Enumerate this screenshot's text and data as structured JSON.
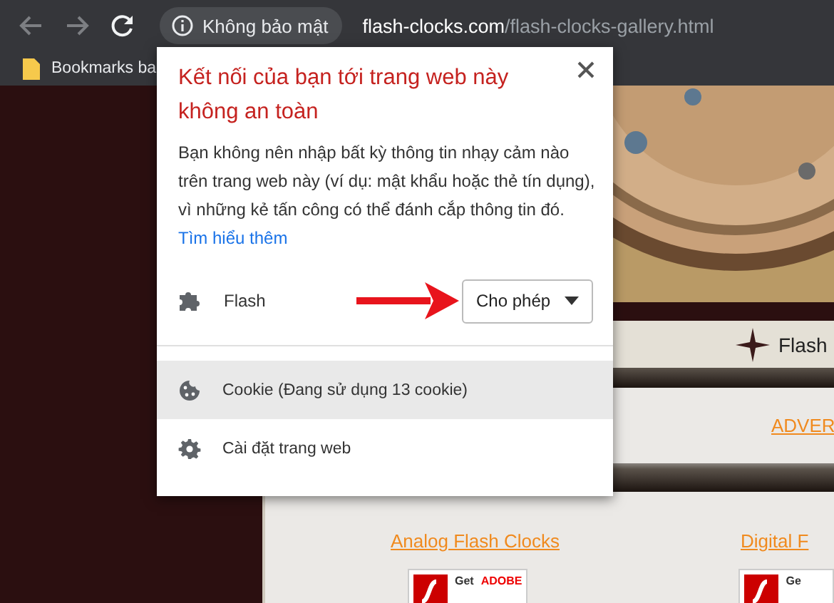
{
  "toolbar": {
    "nav_buttons": [
      {
        "kind": "back",
        "disabled": true
      },
      {
        "kind": "forward",
        "disabled": true
      },
      {
        "kind": "reload",
        "disabled": false
      }
    ],
    "security_chip": "Không bảo mật",
    "url_host": "flash-clocks.com",
    "url_path": "/flash-clocks-gallery.html"
  },
  "bookmarks_bar": {
    "items": [
      "Bookmarks ba"
    ]
  },
  "page": {
    "kind": "picture",
    "header": "Flash",
    "ad_link": "ADVER",
    "links": [
      "Analog Flash Clocks",
      "Digital F"
    ],
    "badges": [
      {
        "get": "Get",
        "brand": "ADOBE"
      },
      {
        "get": "Ge"
      }
    ]
  },
  "popup": {
    "title": "Kết nối của bạn tới trang web này không an toàn",
    "body": "Bạn không nên nhập bất kỳ thông tin nhạy cảm nào trên trang web này (ví dụ: mật khẩu hoặc thẻ tín dụng), vì những kẻ tấn công có thể đánh cắp thông tin đó.",
    "link": "Tìm hiểu thêm",
    "permissions": [
      {
        "name": "Flash",
        "value": "Cho phép"
      }
    ],
    "items": [
      {
        "kind": "cookie",
        "label": "Cookie (Đang sử dụng 13 cookie)",
        "selected": true
      },
      {
        "kind": "settings",
        "label": "Cài đặt trang web",
        "selected": false
      }
    ]
  }
}
